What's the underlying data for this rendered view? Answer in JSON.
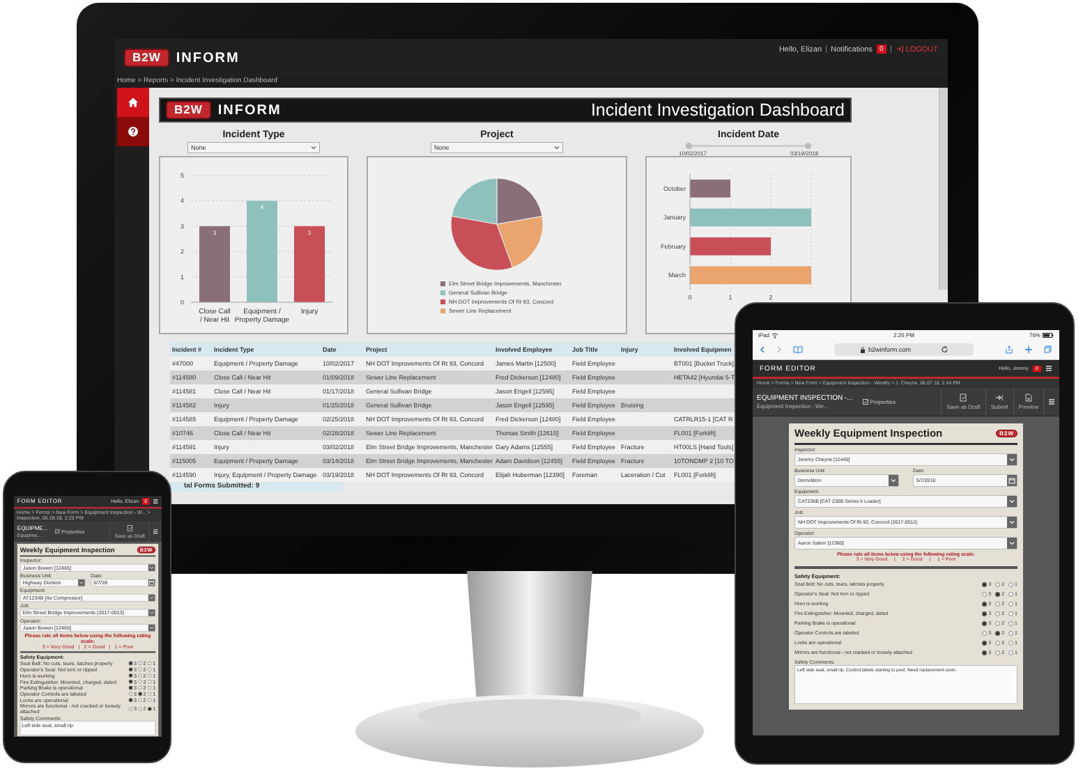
{
  "monitor": {
    "topbar": {
      "logo": "B2W",
      "brand": "INFORM",
      "greeting": "Hello, Elizan",
      "notifications_label": "Notifications",
      "notifications_count": "0",
      "logout": "LOGOUT"
    },
    "breadcrumb": "Home > Reports > Incident Investigation Dashboard",
    "sidebar": [
      {
        "kind": "home",
        "selected": true
      },
      {
        "kind": "help",
        "selected": false
      }
    ],
    "header": {
      "logo": "B2W",
      "brand": "INFORM",
      "title": "Incident Investigation Dashboard"
    },
    "filters": [
      {
        "kind": "select",
        "label": "Incident Type",
        "value": "None"
      },
      {
        "kind": "select",
        "label": "Project",
        "value": "None"
      },
      {
        "kind": "range",
        "label": "Incident Date",
        "start": "10/02/2017",
        "end": "03/19/2018",
        "handles": [
          {
            "level": 0
          },
          {
            "level": 1
          }
        ]
      }
    ],
    "charts": [
      {
        "chart_data": {
          "type": "bar",
          "categories": [
            "Close Call / Near Hit",
            "Equipment / Property Damage",
            "Injury"
          ],
          "stacked": true,
          "grid": true,
          "data_labels": true,
          "ylim": [
            0,
            5
          ],
          "yticks": [
            0,
            1,
            2,
            3,
            4,
            5
          ],
          "series": [
            {
              "color": "#8a6f7a",
              "values": [
                3,
                null,
                null
              ]
            },
            {
              "color": "#8fc1bc",
              "values": [
                null,
                4,
                null
              ]
            },
            {
              "color": "#c84f58",
              "values": [
                null,
                null,
                3
              ]
            }
          ]
        }
      },
      {
        "chart_data": {
          "type": "pie",
          "categories": [
            "Elm Street Bridge Improvements, Manchester",
            "General Sullivan Bridge",
            "NH DOT Improvements Of Rt 93, Concord",
            "Sewer Line Replacement"
          ],
          "values": [
            22.22,
            22.22,
            33.34,
            22.22
          ],
          "legend": "bottom",
          "colors": [
            "#8a6f7a",
            "#8fc1bc",
            "#c84f58",
            "#eaa46e"
          ]
        }
      },
      {
        "chart_data": {
          "type": "bar",
          "orientation": "horizontal",
          "grid": true,
          "categories": [
            "October",
            "January",
            "February",
            "March"
          ],
          "stacked": true,
          "xlim": [
            0,
            3
          ],
          "xticks": [
            0,
            1,
            2
          ],
          "series": [
            {
              "color": "#8a6f7a",
              "values": [
                1,
                null,
                null,
                null
              ]
            },
            {
              "color": "#8fc1bc",
              "values": [
                null,
                3,
                null,
                null
              ]
            },
            {
              "color": "#c84f58",
              "values": [
                null,
                null,
                2,
                null
              ]
            },
            {
              "color": "#eaa46e",
              "values": [
                null,
                null,
                null,
                3
              ]
            }
          ]
        }
      }
    ],
    "table": {
      "columns": [
        "Incident #",
        "Incident Type",
        "Date",
        "Project",
        "Involved Employee",
        "Job Title",
        "Injury",
        "Involved Equipmen"
      ],
      "rows": [
        {
          "incident": "#47000",
          "type": "Equipment / Property Damage",
          "date": "10/02/2017",
          "project": "NH DOT Improvements Of Rt 93, Concord",
          "employee": "James Martin [12500]",
          "job_title": "Field Employee",
          "equipment": "BT001 [Bucket Truck]"
        },
        {
          "incident": "#114580",
          "type": "Close Call / Near Hit",
          "date": "01/09/2018",
          "project": "Sewer Line Replacement",
          "employee": "Fred Dickerson [12480]",
          "job_title": "Field Employee",
          "equipment": "HETA42 [Hyundai 5-T"
        },
        {
          "incident": "#114581",
          "type": "Close Call / Near Hit",
          "date": "01/17/2018",
          "project": "General Sullivan Bridge",
          "employee": "Jason Engell [12595]",
          "job_title": "Field Employee"
        },
        {
          "incident": "#114582",
          "type": "Injury",
          "date": "01/25/2018",
          "project": "General Sullivan Bridge",
          "employee": "Jason Engell [12595]",
          "job_title": "Field Employee",
          "injury": "Bruising"
        },
        {
          "incident": "#114585",
          "type": "Equipment / Property Damage",
          "date": "02/25/2018",
          "project": "NH DOT Improvements Of Rt 93, Concord",
          "employee": "Fred Dickerson [12480]",
          "job_title": "Field Employee",
          "equipment": "CATRLR15-1 [CAT R"
        },
        {
          "incident": "#10746",
          "type": "Close Call / Near Hit",
          "date": "02/28/2018",
          "project": "Sewer Line Replacement",
          "employee": "Thomas Smith [12615]",
          "job_title": "Field Employee",
          "equipment": "FL001 [Forklift]"
        },
        {
          "incident": "#114591",
          "type": "Injury",
          "date": "03/02/2018",
          "project": "Elm Street Bridge Improvements, Manchester",
          "employee": "Gary Adams [12555]",
          "job_title": "Field Employee",
          "injury": "Fracture",
          "equipment": "HT00LS [Hand Tools]"
        },
        {
          "incident": "#115005",
          "type": "Equipment / Property Damage",
          "date": "03/14/2018",
          "project": "Elm Street Bridge Improvements, Manchester",
          "employee": "Adam Davidson [12455]",
          "job_title": "Field Employee",
          "injury": "Fracture",
          "equipment": "10TONDMP 2 [10 TO"
        },
        {
          "incident": "#114590",
          "type": "Injury, Equipment / Property Damage",
          "date": "03/19/2018",
          "project": "NH DOT Improvements Of Rt 93, Concord",
          "employee": "Elijah Huberman [12390]",
          "job_title": "Foreman",
          "injury": "Laceration / Cut",
          "equipment": "FL001 [Forklift]"
        }
      ]
    },
    "total": "tal Forms Submitted: 9"
  },
  "tablet": {
    "status": {
      "device": "iPad",
      "time": "2:25 PM",
      "battery": "76%"
    },
    "url": "b2winform.com",
    "app_title": "FORM EDITOR",
    "greeting": "Hello, Jeremy",
    "notifications_count": "0",
    "breadcrumb": "Home > Forms > New Form > Equipment Inspection - Weekly > J. Cheyne, 06.07.18, 2:24 PM",
    "form_title": "EQUIPMENT INSPECTION -...",
    "form_subtitle": "Equipment Inspection - We...",
    "properties": {
      "label": "Properties",
      "checked": true
    },
    "actions": [
      {
        "kind": "draft",
        "label": "Save as Draft"
      },
      {
        "kind": "submit",
        "label": "Submit"
      },
      {
        "kind": "preview",
        "label": "Preview"
      }
    ],
    "form": {
      "title": "Weekly Equipment Inspection",
      "logo": "B2W",
      "fields": [
        [
          {
            "kind": "select",
            "label": "Inspector:",
            "value": "Jeremy Cheyne [12440]"
          }
        ],
        [
          {
            "kind": "select",
            "label": "Business Unit:",
            "value": "Demolition"
          },
          {
            "kind": "date",
            "label": "Date:",
            "value": "5/7/2018"
          }
        ],
        [
          {
            "kind": "select",
            "label": "Equipment:",
            "value": "CAT236B [CAT 236B Series II Loader]"
          }
        ],
        [
          {
            "kind": "select",
            "label": "Job:",
            "value": "NH DOT Improvements Of Rt 93, Concord (2017-0012)"
          }
        ],
        [
          {
            "kind": "select",
            "label": "Operator:",
            "value": "Aaron Salem [12360]"
          }
        ]
      ],
      "notice": "Please rate all items below using the following rating scale:",
      "scale": "3 = Very Good     |     2 = Good     |     1 = Poor",
      "section": "Safety Equipment:",
      "items": [
        {
          "label": "Seat Belt: No cuts, tears, latches properly",
          "options": [
            {
              "label": "3",
              "selected": true
            },
            {
              "label": "2",
              "selected": false
            },
            {
              "label": "1",
              "selected": false
            }
          ]
        },
        {
          "label": "Operator's Seat: Not torn or ripped",
          "options": [
            {
              "label": "3",
              "selected": false
            },
            {
              "label": "2",
              "selected": true
            },
            {
              "label": "1",
              "selected": false
            }
          ]
        },
        {
          "label": "Horn is working",
          "options": [
            {
              "label": "3",
              "selected": true
            },
            {
              "label": "2",
              "selected": false
            },
            {
              "label": "1",
              "selected": false
            }
          ]
        },
        {
          "label": "Fire Extinguisher: Mounted, charged, dated",
          "options": [
            {
              "label": "3",
              "selected": true
            },
            {
              "label": "2",
              "selected": false
            },
            {
              "label": "1",
              "selected": false
            }
          ]
        },
        {
          "label": "Parking Brake is operational",
          "options": [
            {
              "label": "3",
              "selected": true
            },
            {
              "label": "2",
              "selected": false
            },
            {
              "label": "1",
              "selected": false
            }
          ]
        },
        {
          "label": "Operator Controls are labeled",
          "options": [
            {
              "label": "3",
              "selected": false
            },
            {
              "label": "2",
              "selected": true
            },
            {
              "label": "1",
              "selected": false
            }
          ]
        },
        {
          "label": "Locks are operational",
          "options": [
            {
              "label": "3",
              "selected": true
            },
            {
              "label": "2",
              "selected": false
            },
            {
              "label": "1",
              "selected": false
            }
          ]
        },
        {
          "label": "Mirrors are functional - not cracked or loosely attached",
          "options": [
            {
              "label": "3",
              "selected": true
            },
            {
              "label": "2",
              "selected": false
            },
            {
              "label": "1",
              "selected": false
            }
          ]
        }
      ],
      "comments_label": "Safety Comments:",
      "comments": "Left side seat, small rip. Control labels starting to peel. Need replacement soon."
    }
  },
  "phone": {
    "app_title": "FORM EDITOR",
    "greeting": "Hello, Elizan",
    "notifications_count": "0",
    "breadcrumb": "Home > Forms > New Form > Equipment Inspection - W... > Inspection, 06.18.18, 2:25 PM",
    "form_title": "EQUIPME...",
    "form_subtitle": "Equipme...",
    "properties": {
      "label": "Properties",
      "checked": true
    },
    "actions": [
      {
        "kind": "draft",
        "label": "Save as Draft"
      }
    ],
    "form": {
      "title": "Weekly Equipment Inspection",
      "logo": "B2W",
      "fields": [
        [
          {
            "kind": "select",
            "label": "Inspector:",
            "value": "Jason Bowen [12465]"
          }
        ],
        [
          {
            "kind": "select",
            "label": "Business Unit:",
            "value": "Highway Division"
          },
          {
            "kind": "date",
            "label": "Date:",
            "value": "5/7/18"
          }
        ],
        [
          {
            "kind": "select",
            "label": "Equipment:",
            "value": "AT1234B [Air Compressor]"
          }
        ],
        [
          {
            "kind": "select",
            "label": "Job:",
            "value": "Elm Street Bridge Improvements (2017-0013)"
          }
        ],
        [
          {
            "kind": "select",
            "label": "Operator:",
            "value": "Jason Bowen [12465]"
          }
        ]
      ],
      "notice": "Please rate all items below using the following rating scale:",
      "scale": "3 = Very Good   |   2 = Good   |   1 = Poor",
      "section": "Safety Equipment:",
      "items": [
        {
          "label": "Seat Belt: No cuts, tears, latches properly",
          "options": [
            {
              "label": "3",
              "selected": true
            },
            {
              "label": "2",
              "selected": false
            },
            {
              "label": "1",
              "selected": false
            }
          ]
        },
        {
          "label": "Operator's Seat: Not torn or ripped",
          "options": [
            {
              "label": "3",
              "selected": true
            },
            {
              "label": "2",
              "selected": false
            },
            {
              "label": "1",
              "selected": false
            }
          ]
        },
        {
          "label": "Horn is working",
          "options": [
            {
              "label": "3",
              "selected": true
            },
            {
              "label": "2",
              "selected": false
            },
            {
              "label": "1",
              "selected": false
            }
          ]
        },
        {
          "label": "Fire Extinguisher: Mounted, charged, dated",
          "options": [
            {
              "label": "3",
              "selected": true
            },
            {
              "label": "2",
              "selected": false
            },
            {
              "label": "1",
              "selected": false
            }
          ]
        },
        {
          "label": "Parking Brake is operational",
          "options": [
            {
              "label": "3",
              "selected": true
            },
            {
              "label": "2",
              "selected": false
            },
            {
              "label": "1",
              "selected": false
            }
          ]
        },
        {
          "label": "Operator Controls are labeled",
          "options": [
            {
              "label": "3",
              "selected": false
            },
            {
              "label": "2",
              "selected": true
            },
            {
              "label": "1",
              "selected": false
            }
          ]
        },
        {
          "label": "Locks are operational",
          "options": [
            {
              "label": "3",
              "selected": true
            },
            {
              "label": "2",
              "selected": false
            },
            {
              "label": "1",
              "selected": false
            }
          ]
        },
        {
          "label": "Mirrors are functional - not cracked or loosely attached",
          "options": [
            {
              "label": "3",
              "selected": false
            },
            {
              "label": "2",
              "selected": false
            },
            {
              "label": "1",
              "selected": true
            }
          ]
        }
      ],
      "comments_label": "Safety Comments:",
      "comments": "Left side seat, small rip."
    }
  }
}
